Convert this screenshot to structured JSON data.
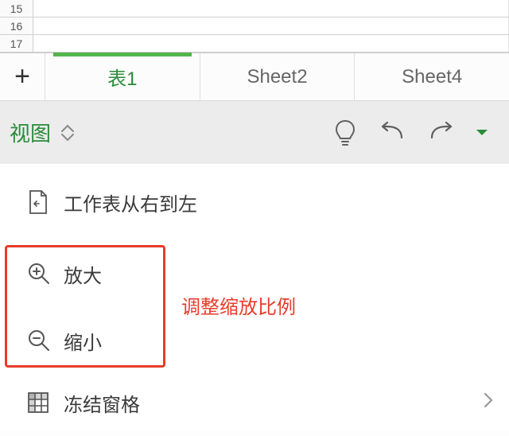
{
  "rows": [
    "15",
    "16",
    "17"
  ],
  "sheets": {
    "add_label": "+",
    "tabs": [
      {
        "label": "表1",
        "active": true
      },
      {
        "label": "Sheet2",
        "active": false
      },
      {
        "label": "Sheet4",
        "active": false
      }
    ]
  },
  "toolbar": {
    "view_label": "视图"
  },
  "menu": {
    "rtl_label": "工作表从右到左",
    "zoom_in_label": "放大",
    "zoom_out_label": "缩小",
    "freeze_label": "冻结窗格",
    "annotation": "调整缩放比例"
  }
}
